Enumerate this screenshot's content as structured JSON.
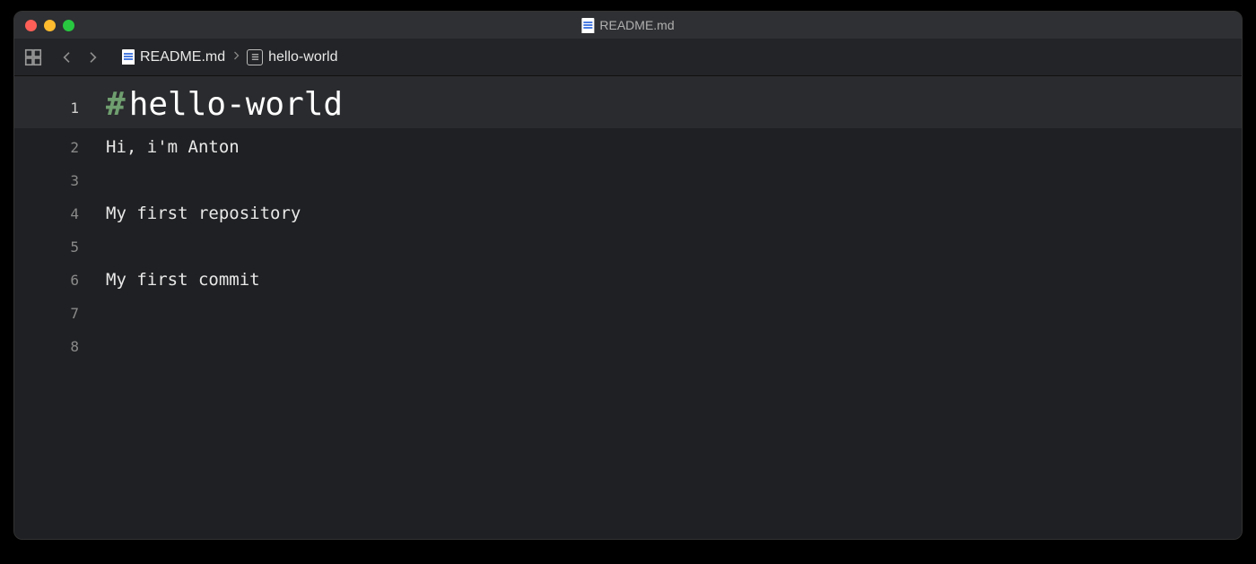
{
  "titlebar": {
    "title": "README.md"
  },
  "breadcrumb": {
    "file": "README.md",
    "symbol": "hello-world"
  },
  "editor": {
    "hash": "#",
    "heading": "hello-world",
    "lines": [
      {
        "n": "1"
      },
      {
        "n": "2",
        "text": "Hi, i'm Anton"
      },
      {
        "n": "3",
        "text": ""
      },
      {
        "n": "4",
        "text": "My first repository"
      },
      {
        "n": "5",
        "text": ""
      },
      {
        "n": "6",
        "text": "My first commit"
      },
      {
        "n": "7",
        "text": ""
      },
      {
        "n": "8",
        "text": ""
      }
    ]
  }
}
